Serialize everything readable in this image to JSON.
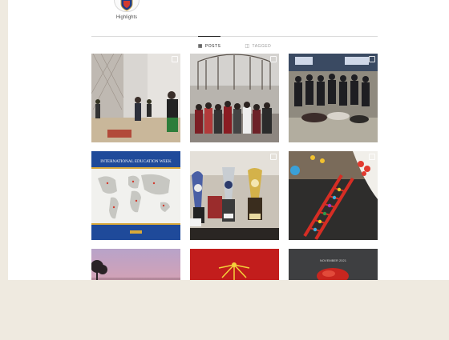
{
  "highlights": [
    {
      "label": "Highlights"
    }
  ],
  "tabs": [
    {
      "label": "POSTS",
      "icon": "grid-icon",
      "active": true
    },
    {
      "label": "TAGGED",
      "icon": "tag-icon",
      "active": false
    }
  ],
  "posts": [
    {
      "subject": "gym-activity"
    },
    {
      "subject": "group-under-gate"
    },
    {
      "subject": "team-group-photo"
    },
    {
      "subject": "international-education-week",
      "banner_text": "INTERNATIONAL EDUCATION WEEK"
    },
    {
      "subject": "trophies"
    },
    {
      "subject": "ladder-craft"
    },
    {
      "subject": "sunset-sky"
    },
    {
      "subject": "red-decoration"
    },
    {
      "subject": "red-object",
      "caption": "NOVEMBER 2021"
    }
  ],
  "colors": {
    "background": "#efeae0",
    "page": "#ffffff",
    "divider": "#dbdbdb",
    "active_tab": "#262626"
  }
}
